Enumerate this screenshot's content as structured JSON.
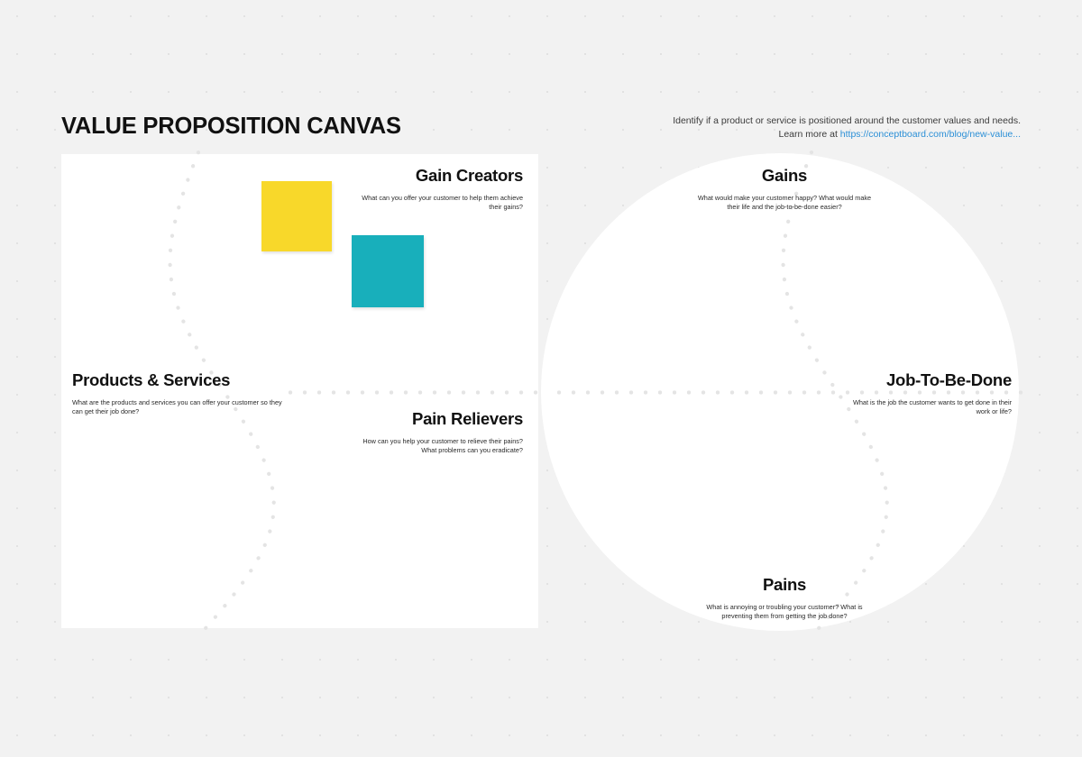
{
  "header": {
    "title": "VALUE PROPOSITION CANVAS",
    "note_line1": "Identify if a product or service is positioned around the customer values and needs.",
    "note_line2_prefix": "Learn more at ",
    "note_link": "https://conceptboard.com/blog/new-value..."
  },
  "sections": {
    "gain_creators": {
      "heading": "Gain Creators",
      "description": "What can you offer your customer to help them achieve their gains?"
    },
    "products_services": {
      "heading": "Products & Services",
      "description": "What are the products and services you can offer your customer so they can get their job done?"
    },
    "pain_relievers": {
      "heading": "Pain Relievers",
      "description": "How can you help your customer to relieve their pains? What problems can you eradicate?"
    },
    "gains": {
      "heading": "Gains",
      "description": "What would make your customer happy? What would make their life and the job-to-be-done easier?"
    },
    "job_to_be_done": {
      "heading": "Job-To-Be-Done",
      "description": "What is the job the customer wants to get done in their work or life?"
    },
    "pains": {
      "heading": "Pains",
      "description": "What is annoying or troubling your customer? What is preventing them from getting the job done?"
    }
  },
  "sticky_notes": [
    {
      "name": "yellow-note",
      "color": "#f8d82a",
      "text": ""
    },
    {
      "name": "teal-note",
      "color": "#18afbb",
      "text": ""
    }
  ],
  "colors": {
    "background": "#f2f2f2",
    "surface": "#ffffff",
    "link": "#2b8fd6",
    "dots": "#e4e4e4",
    "sticky_yellow": "#f8d82a",
    "sticky_teal": "#18afbb"
  }
}
